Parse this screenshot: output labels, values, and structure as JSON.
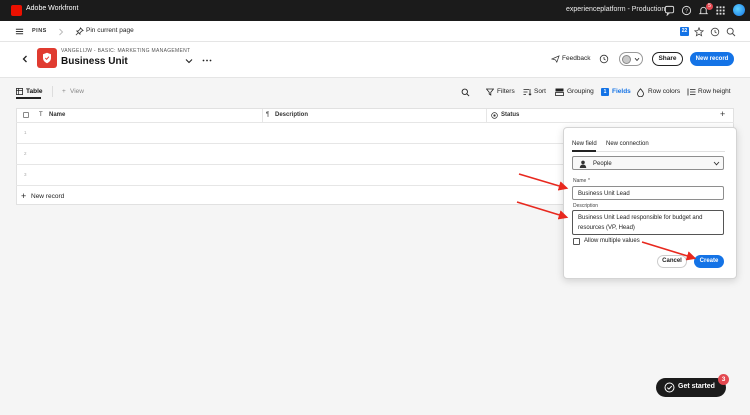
{
  "topbar": {
    "app_name": "Adobe Workfront",
    "environment": "experienceplatform - Production",
    "notification_count": "5"
  },
  "pinsbar": {
    "pins_label": "PINS",
    "pin_current_label": "Pin current page",
    "calendar_day": "22"
  },
  "header": {
    "breadcrumb": "VANGELIJW - BASIC: MARKETING MANAGEMENT",
    "title": "Business Unit",
    "feedback_label": "Feedback",
    "share_label": "Share",
    "new_record_label": "New record"
  },
  "toolbar": {
    "table_tab": "Table",
    "add_view": "View",
    "filters": "Filters",
    "sort": "Sort",
    "grouping": "Grouping",
    "fields_count": "1",
    "fields": "Fields",
    "row_colors": "Row colors",
    "row_height": "Row height"
  },
  "grid": {
    "columns": [
      "Name",
      "Description",
      "Status"
    ],
    "row_numbers": [
      "1",
      "2",
      "3"
    ],
    "new_record_label": "New record"
  },
  "popover": {
    "tabs": [
      "New field",
      "New connection"
    ],
    "active_tab": "New field",
    "field_type": "People",
    "name_label": "Name",
    "name_required_mark": "*",
    "name_value": "Business Unit Lead",
    "description_label": "Description",
    "description_value": "Business Unit Lead responsible for budget and resources (VP, Head)",
    "allow_multiple_label": "Allow multiple values",
    "allow_multiple_checked": false,
    "cancel_label": "Cancel",
    "create_label": "Create"
  },
  "get_started": {
    "label": "Get started",
    "badge": "3"
  },
  "colors": {
    "accent_blue": "#1473e6",
    "annotation_red": "#e8281e",
    "brand_red": "#eb1000"
  },
  "icons": [
    "adobe-logo-icon",
    "menu-icon",
    "pin-icon",
    "back-icon",
    "chevron-down-icon",
    "more-icon",
    "feedback-icon",
    "history-icon",
    "search-icon",
    "filter-icon",
    "sort-icon",
    "grouping-icon",
    "row-colors-icon",
    "row-height-icon",
    "plus-icon",
    "person-icon",
    "star-icon",
    "help-icon",
    "bell-icon",
    "apps-icon"
  ]
}
